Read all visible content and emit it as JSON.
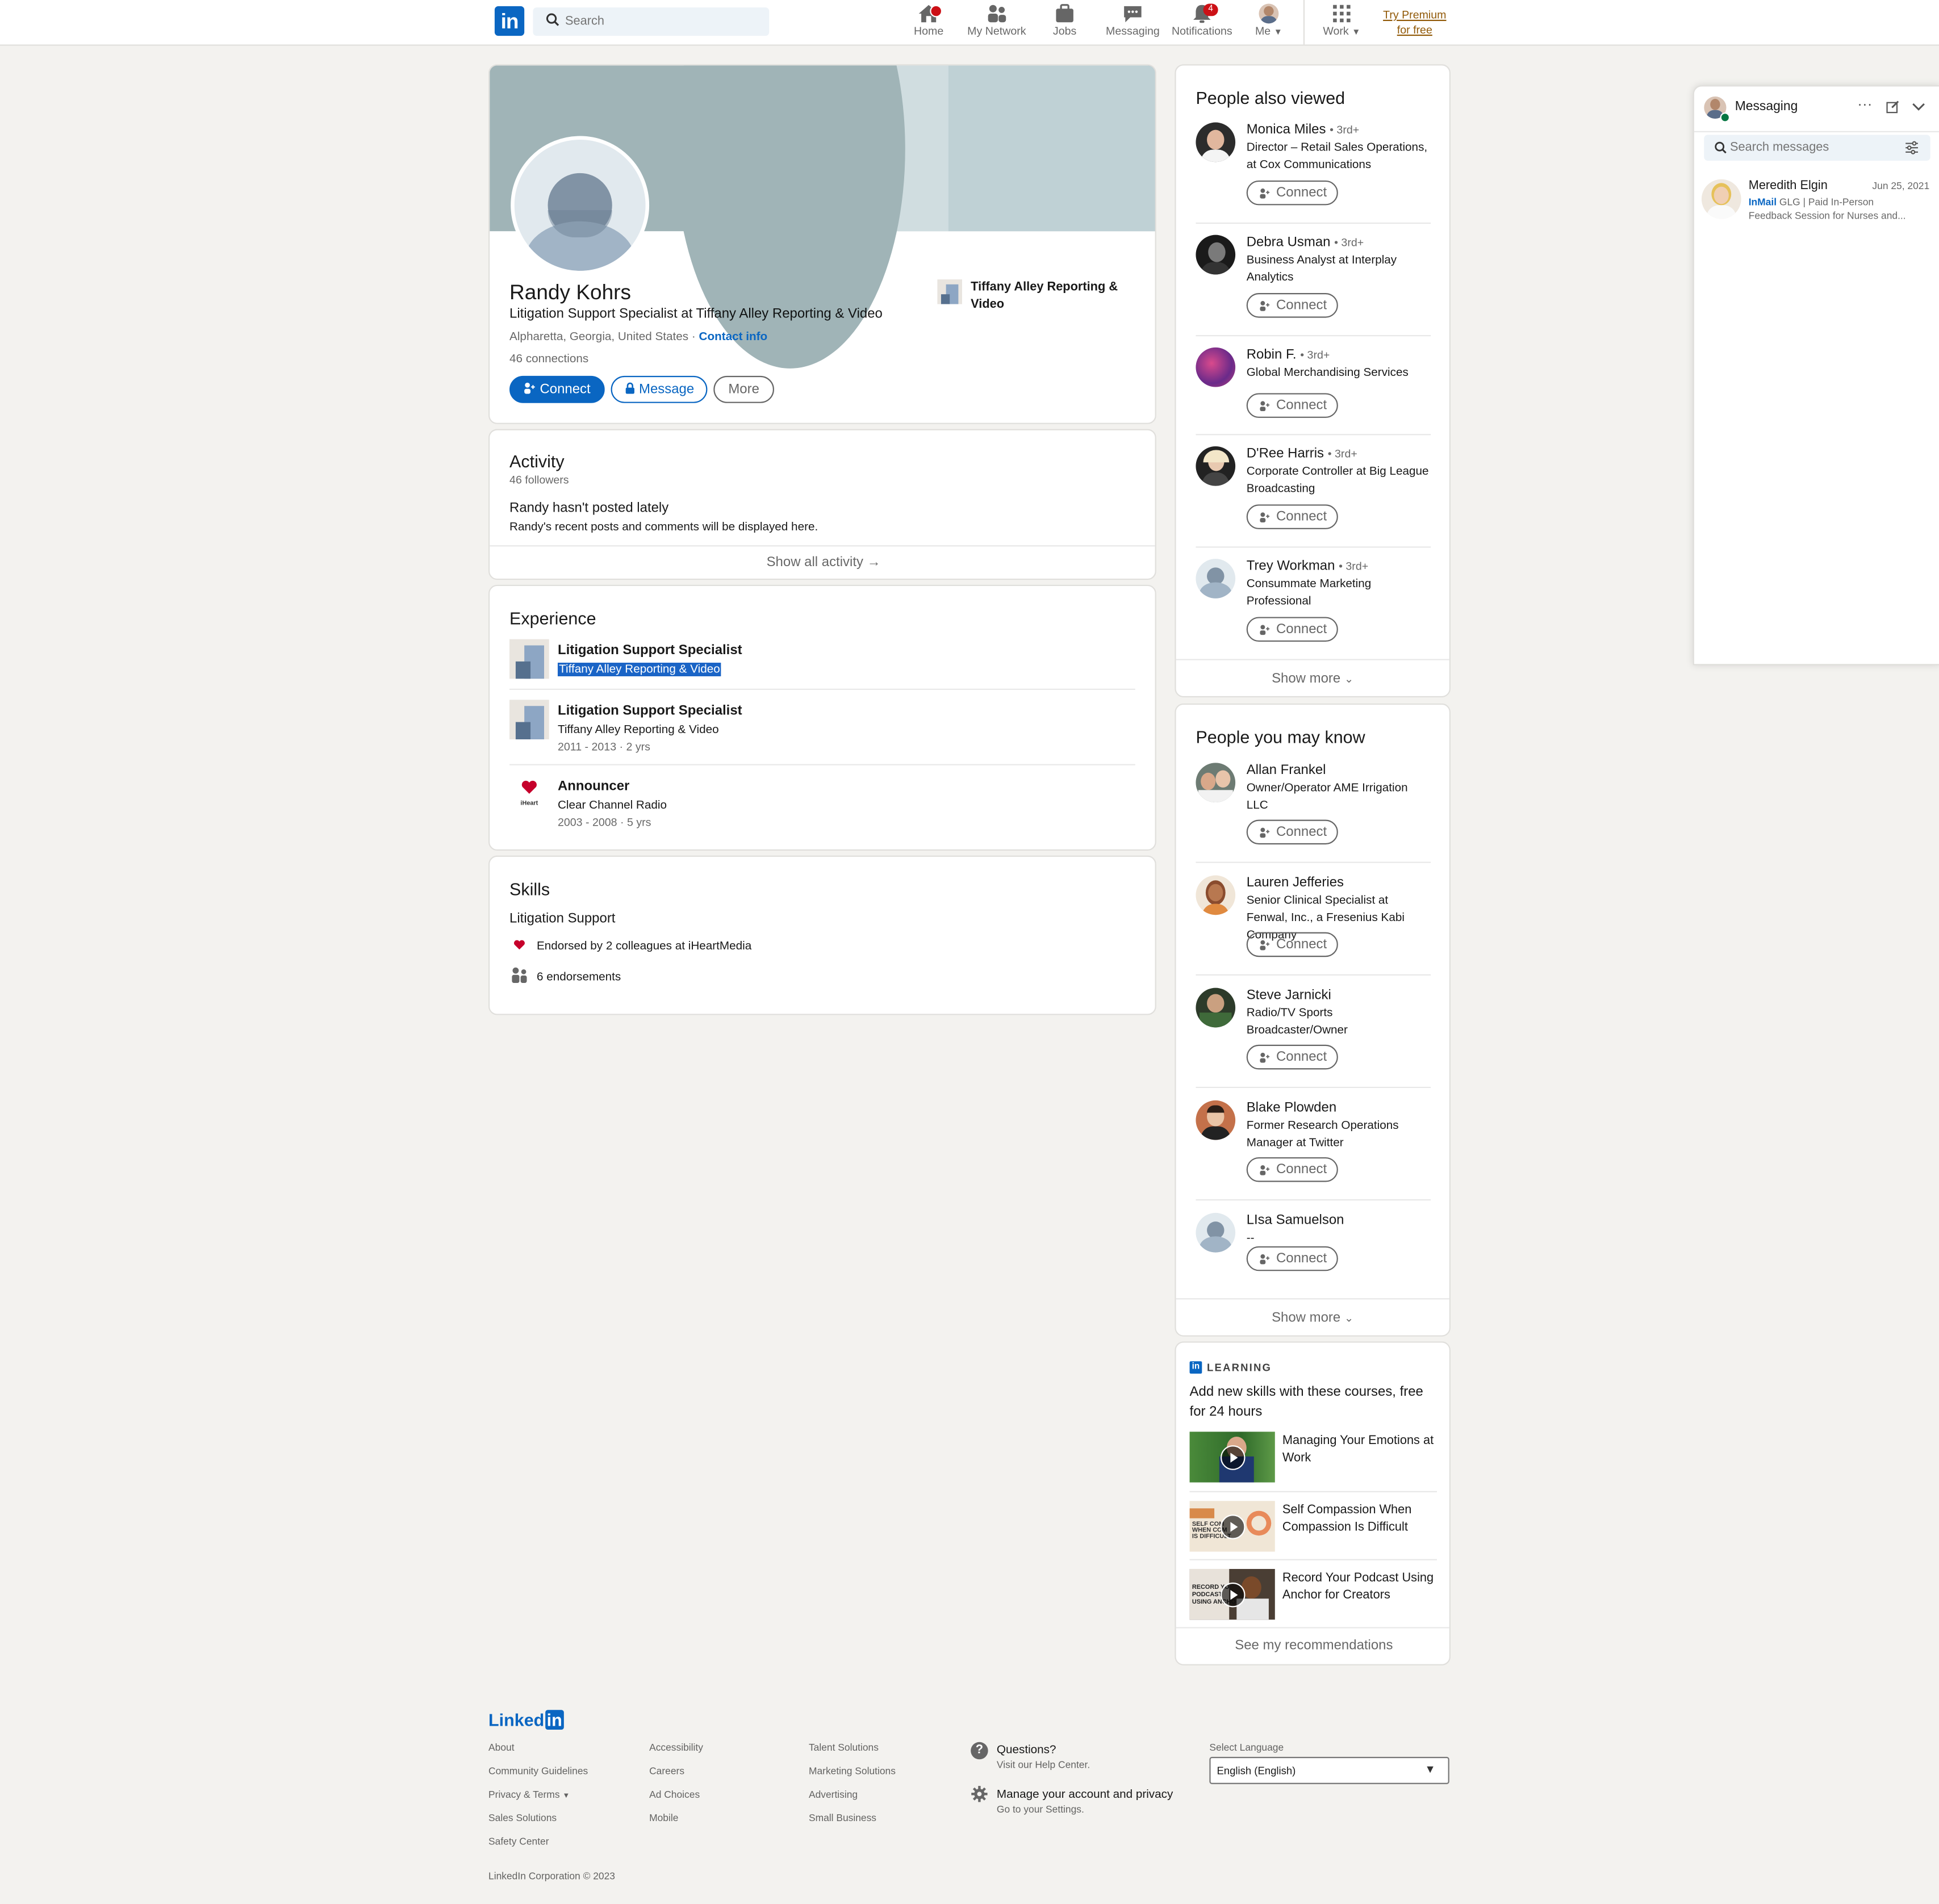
{
  "nav": {
    "logo": "in",
    "search_placeholder": "Search",
    "items": [
      {
        "label": "Home",
        "badge": ""
      },
      {
        "label": "My Network",
        "badge": ""
      },
      {
        "label": "Jobs",
        "badge": ""
      },
      {
        "label": "Messaging",
        "badge": ""
      },
      {
        "label": "Notifications",
        "badge": "4"
      },
      {
        "label": "Me",
        "badge": ""
      },
      {
        "label": "Work",
        "badge": ""
      }
    ],
    "premium": "Try Premium for free"
  },
  "profile": {
    "name": "Randy Kohrs",
    "headline": "Litigation Support Specialist at Tiffany Alley Reporting & Video",
    "location": "Alpharetta, Georgia, United States",
    "dot": "·",
    "contact_info": "Contact info",
    "connections_count": "46",
    "connections_label": "connections",
    "company": "Tiffany Alley Reporting & Video",
    "buttons": {
      "connect": "Connect",
      "message": "Message",
      "more": "More"
    }
  },
  "activity": {
    "title": "Activity",
    "followers": "46 followers",
    "empty_title": "Randy hasn't posted lately",
    "empty_text": "Randy's recent posts and comments will be displayed here.",
    "show_all": "Show all activity →"
  },
  "experience": {
    "title": "Experience",
    "items": [
      {
        "title": "Litigation Support Specialist",
        "company": "Tiffany Alley Reporting & Video",
        "dates": ""
      },
      {
        "title": "Litigation Support Specialist",
        "company": "Tiffany Alley Reporting & Video",
        "dates": "2011 - 2013 · 2 yrs"
      },
      {
        "title": "Announcer",
        "company": "Clear Channel Radio",
        "dates": "2003 - 2008 · 5 yrs"
      }
    ]
  },
  "skills": {
    "title": "Skills",
    "skill": "Litigation Support",
    "endorsed_by": "Endorsed by 2 colleagues at iHeartMedia",
    "endorsements": "6 endorsements"
  },
  "people_also_viewed": {
    "title": "People also viewed",
    "connect": "Connect",
    "show_more": "Show more",
    "people": [
      {
        "name": "Monica Miles",
        "degree": "• 3rd+",
        "headline": "Director – Retail Sales Operations, at Cox Communications"
      },
      {
        "name": "Debra Usman",
        "degree": "• 3rd+",
        "headline": "Business Analyst at Interplay Analytics"
      },
      {
        "name": "Robin F.",
        "degree": "• 3rd+",
        "headline": "Global Merchandising Services"
      },
      {
        "name": "D'Ree Harris",
        "degree": "• 3rd+",
        "headline": "Corporate Controller at Big League Broadcasting"
      },
      {
        "name": "Trey Workman",
        "degree": "• 3rd+",
        "headline": "Consummate Marketing Professional"
      }
    ]
  },
  "people_you_may_know": {
    "title": "People you may know",
    "connect": "Connect",
    "show_more": "Show more",
    "people": [
      {
        "name": "Allan Frankel",
        "headline": "Owner/Operator AME Irrigation LLC"
      },
      {
        "name": "Lauren Jefferies",
        "headline": "Senior Clinical Specialist at Fenwal, Inc., a Fresenius Kabi Company"
      },
      {
        "name": "Steve Jarnicki",
        "headline": "Radio/TV Sports Broadcaster/Owner"
      },
      {
        "name": "Blake Plowden",
        "headline": "Former Research Operations Manager at Twitter"
      },
      {
        "name": "LIsa Samuelson",
        "headline": "--"
      }
    ]
  },
  "learning": {
    "label": "LEARNING",
    "intro": "Add new skills with these courses, free for 24 hours",
    "courses": [
      {
        "title": "Managing Your Emotions at Work"
      },
      {
        "title": "Self Compassion When Compassion Is Difficult"
      },
      {
        "title": "Record Your Podcast Using Anchor for Creators"
      }
    ],
    "see_more": "See my recommendations"
  },
  "messaging": {
    "title": "Messaging",
    "search_placeholder": "Search messages",
    "conversations": [
      {
        "name": "Meredith Elgin",
        "date": "Jun 25, 2021",
        "tag": "InMail",
        "preview1": "GLG | Paid In-Person",
        "preview2": "Feedback Session for Nurses and..."
      }
    ]
  },
  "footer": {
    "logo_text": "Linked",
    "logo_in": "in",
    "col1": [
      "About",
      "Community Guidelines",
      "Privacy & Terms",
      "Sales Solutions",
      "Safety Center"
    ],
    "col2": [
      "Accessibility",
      "Careers",
      "Ad Choices",
      "Mobile"
    ],
    "col3": [
      "Talent Solutions",
      "Marketing Solutions",
      "Advertising",
      "Small Business"
    ],
    "questions_title": "Questions?",
    "questions_sub": "Visit our Help Center.",
    "manage_title": "Manage your account and privacy",
    "manage_sub": "Go to your Settings.",
    "select_language_label": "Select Language",
    "language": "English (English)",
    "copyright": "LinkedIn Corporation © 2023"
  },
  "colors": {
    "brand": "#0a66c2",
    "badge": "#cc1016",
    "premium": "#915907",
    "page_bg": "#f3f2ef"
  }
}
